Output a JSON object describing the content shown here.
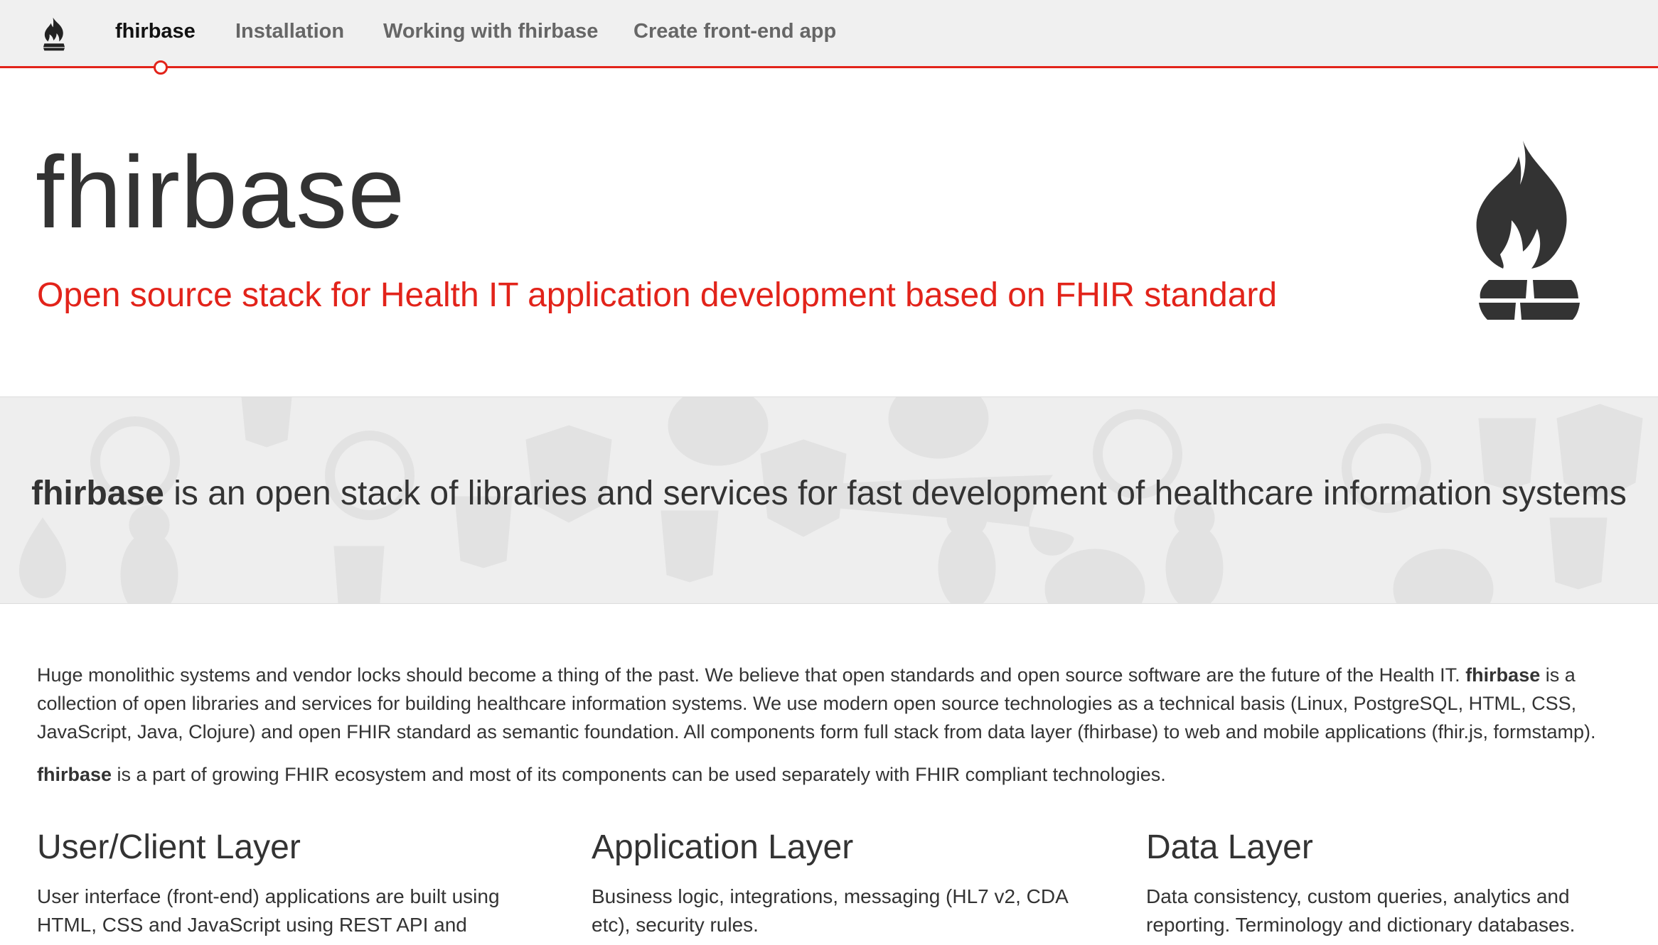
{
  "nav": {
    "logo_icon": "fhirbase-flame-icon",
    "items": [
      {
        "label": "fhirbase",
        "active": true
      },
      {
        "label": "Installation",
        "active": false
      },
      {
        "label": "Working with fhirbase",
        "active": false
      },
      {
        "label": "Create front-end app",
        "active": false
      }
    ]
  },
  "hero": {
    "title": "fhirbase",
    "subtitle": "Open source stack for Health IT application development based on FHIR standard",
    "logo_icon": "fhirbase-flame-icon"
  },
  "banner": {
    "brand": "fhirbase",
    "text": " is an open stack of libraries and services for fast development of healthcare information systems",
    "background_icons": [
      "html5-icon",
      "angular-icon",
      "linux-penguin-icon",
      "postgresql-elephant-icon",
      "clojure-icon"
    ]
  },
  "intro": {
    "p1_a": "Huge monolithic systems and vendor locks should become a thing of the past. We believe that open standards and open source software are the future of the Health IT. ",
    "p1_brand": "fhirbase",
    "p1_b": " is a collection of open libraries and services for building healthcare information systems. We use modern open source technologies as a technical basis (Linux, PostgreSQL, HTML, CSS, JavaScript, Java, Clojure) and open FHIR standard as semantic foundation. All components form full stack from data layer (fhirbase) to web and mobile applications (fhir.js, formstamp).",
    "p2_brand": "fhirbase",
    "p2": " is a part of growing FHIR ecosystem and most of its components can be used separately with FHIR compliant technologies."
  },
  "columns": [
    {
      "title": "User/Client Layer",
      "text": "User interface (front-end) applications are built using HTML, CSS and JavaScript using REST API and"
    },
    {
      "title": "Application Layer",
      "text": "Business logic, integrations, messaging (HL7 v2, CDA etc), security rules."
    },
    {
      "title": "Data Layer",
      "text": "Data consistency, custom queries, analytics and reporting. Terminology and dictionary databases."
    }
  ],
  "colors": {
    "accent": "#e2231a",
    "nav_bg": "#f0f0f0",
    "banner_bg": "#eeeeee",
    "text": "#333333"
  }
}
